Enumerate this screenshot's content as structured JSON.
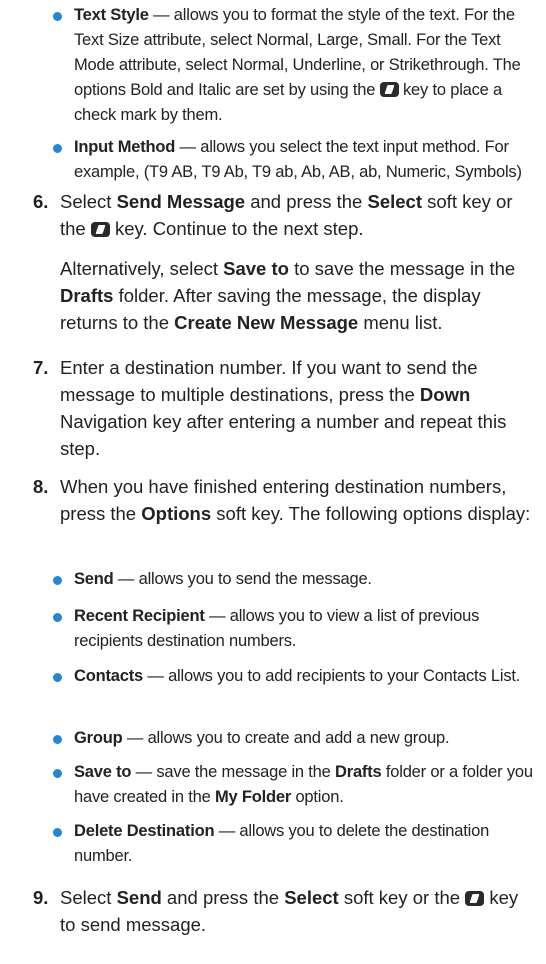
{
  "b_textstyle": {
    "title": "Text Style",
    "d1": " — allows you to format the style of the text. For the Text Size attribute, select Normal, Large, Small. For the Text Mode attribute, select Normal, Underline, or Strikethrough. The options Bold and Italic are set by using the ",
    "d2": " key to place a check mark by them."
  },
  "b_input": {
    "title": "Input Method",
    "d1": " — allows you select the text input method. For example, (T9 AB, T9 Ab, T9 ab, Ab, AB, ab, Numeric, Symbols)"
  },
  "s6": {
    "num": "6.",
    "t1": "Select ",
    "b1": "Send Message",
    "t2": " and press the ",
    "b2": "Select",
    "t3": " soft key or the ",
    "t4": " key. Continue to the next step."
  },
  "p6b": {
    "t1": "Alternatively, select ",
    "b1": "Save to",
    "t2": " to save the message in the ",
    "b2": "Drafts",
    "t3": " folder. After saving the message, the display returns to the ",
    "b3": "Create New Message",
    "t4": " menu list."
  },
  "s7": {
    "num": "7.",
    "t1": "Enter a destination number. If you want to send the message to multiple destinations, press the ",
    "b1": "Down",
    "t2": " Navigation key after entering a number and repeat this step."
  },
  "s8": {
    "num": "8.",
    "t1": "When you have finished entering destination numbers, press the ",
    "b1": "Options",
    "t2": " soft key. The following options display:"
  },
  "b_send": {
    "title": "Send",
    "d1": " — allows you to send the message."
  },
  "b_recent": {
    "title": "Recent Recipient",
    "d1": " — allows you to view a list of previous recipients destination numbers."
  },
  "b_contacts": {
    "title": "Contacts",
    "d1": " — allows you to add recipients to your Contacts List."
  },
  "b_group": {
    "title": "Group",
    "d1": " — allows you to create and add a new group."
  },
  "b_saveto": {
    "title": "Save to",
    "d1": " — save the message in the ",
    "b1": "Drafts",
    "d2": " folder or a folder you have created in the ",
    "b2": "My Folder",
    "d3": " option."
  },
  "b_deldest": {
    "title": "Delete Destination",
    "d1": " — allows you to delete the destination number."
  },
  "s9": {
    "num": "9.",
    "t1": "Select ",
    "b1": "Send",
    "t2": " and press the ",
    "b2": "Select",
    "t3": " soft key or the ",
    "t4": " key to send message."
  },
  "colors": {
    "bullet": "#1f86d8",
    "text": "#222222"
  },
  "icons": {
    "action_key": "menu-ok-key-icon"
  }
}
